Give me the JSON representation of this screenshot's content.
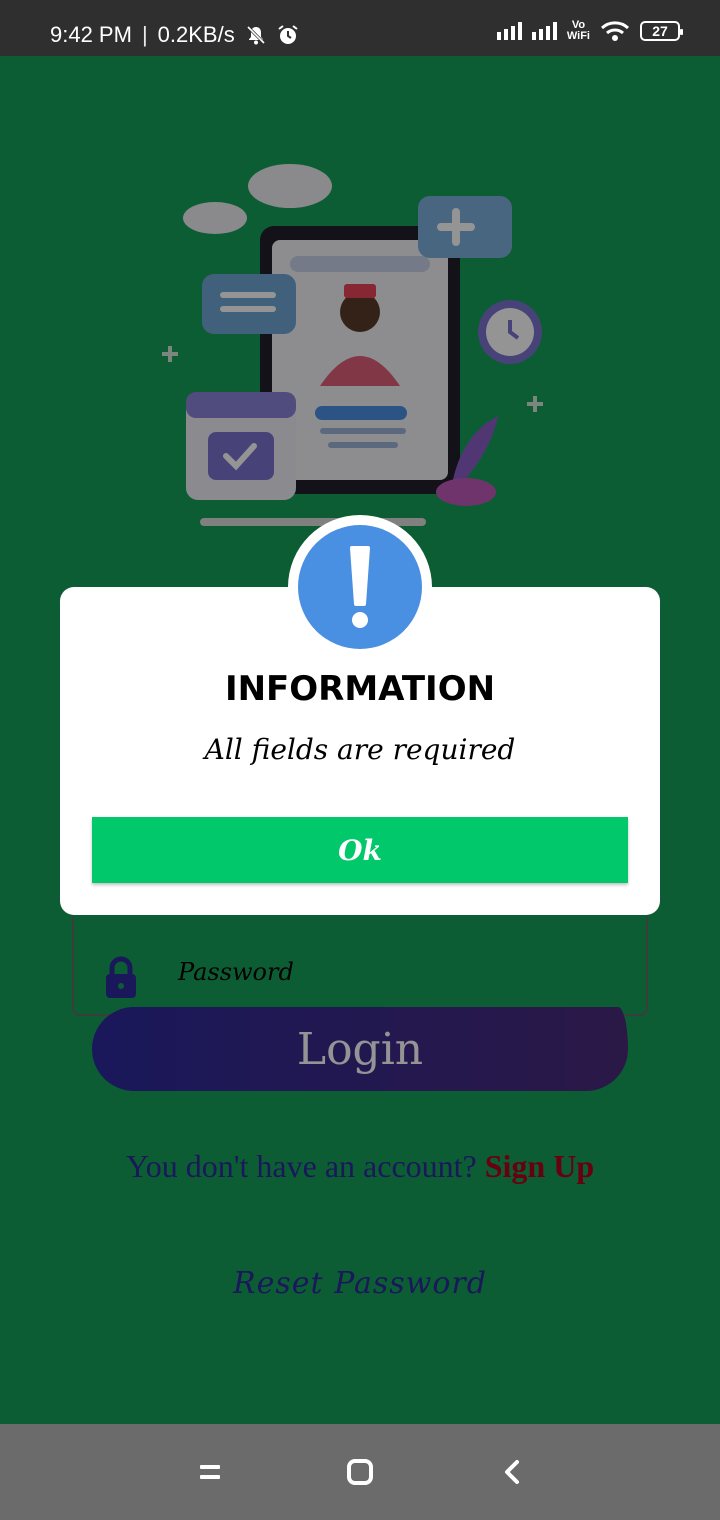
{
  "status_bar": {
    "time": "9:42 PM",
    "net_speed": "0.2KB/s",
    "vowifi": "Vo\nWiFi",
    "battery": "27"
  },
  "form": {
    "password_placeholder": "Password",
    "login_label": "Login",
    "signup_prompt": "You don't have an account?",
    "signup_link": "Sign Up",
    "reset_label": "Reset Password"
  },
  "dialog": {
    "title": "INFORMATION",
    "message": "All fields are required",
    "ok_label": "Ok",
    "icon": "exclamation-icon"
  },
  "colors": {
    "background": "#15a05a",
    "dialog_icon": "#4a90e2",
    "ok_button": "#02c86c",
    "login_button": "#2d2a9c",
    "signup_link": "#b3001a"
  }
}
